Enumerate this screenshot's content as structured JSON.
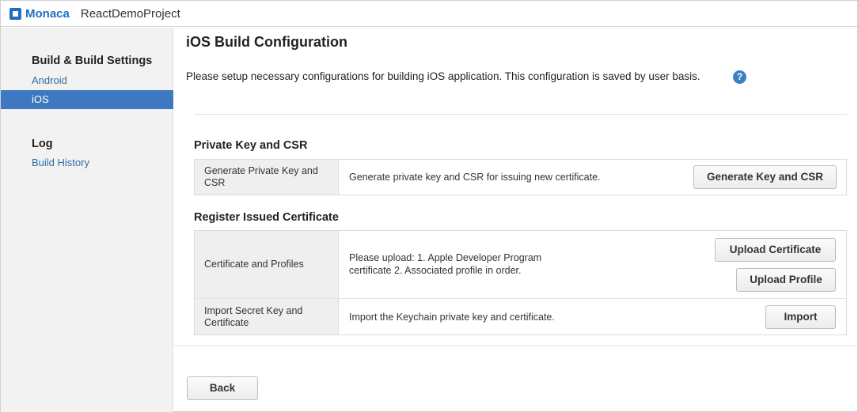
{
  "titlebar": {
    "brand": "Monaca",
    "project": "ReactDemoProject"
  },
  "sidebar": {
    "build_heading": "Build & Build Settings",
    "build_items": [
      {
        "label": "Android",
        "active": false
      },
      {
        "label": "iOS",
        "active": true
      }
    ],
    "log_heading": "Log",
    "log_items": [
      {
        "label": "Build History"
      }
    ]
  },
  "main": {
    "title": "iOS Build Configuration",
    "intro": "Please setup necessary configurations for building iOS application. This configuration is saved by user basis.",
    "help_icon": "?",
    "private_key_section": {
      "title": "Private Key and CSR",
      "rows": [
        {
          "label": "Generate Private Key and CSR",
          "description": "Generate private key and CSR for issuing new certificate.",
          "button": "Generate Key and CSR"
        }
      ]
    },
    "certificate_section": {
      "title": "Register Issued Certificate",
      "rows": [
        {
          "label": "Certificate and Profiles",
          "description_line1": "Please upload: 1. Apple Developer Program",
          "description_line2": "certificate  2. Associated profile  in order.",
          "button_upload_certificate": "Upload Certificate",
          "button_upload_profile": "Upload Profile"
        },
        {
          "label": "Import Secret Key and Certificate",
          "description": "Import the Keychain private key and certificate.",
          "button": "Import"
        }
      ]
    },
    "back_button": "Back"
  },
  "colors": {
    "brand": "#1f6fbf",
    "sidebar_active": "#3d78c0",
    "link": "#2d6ea8"
  }
}
